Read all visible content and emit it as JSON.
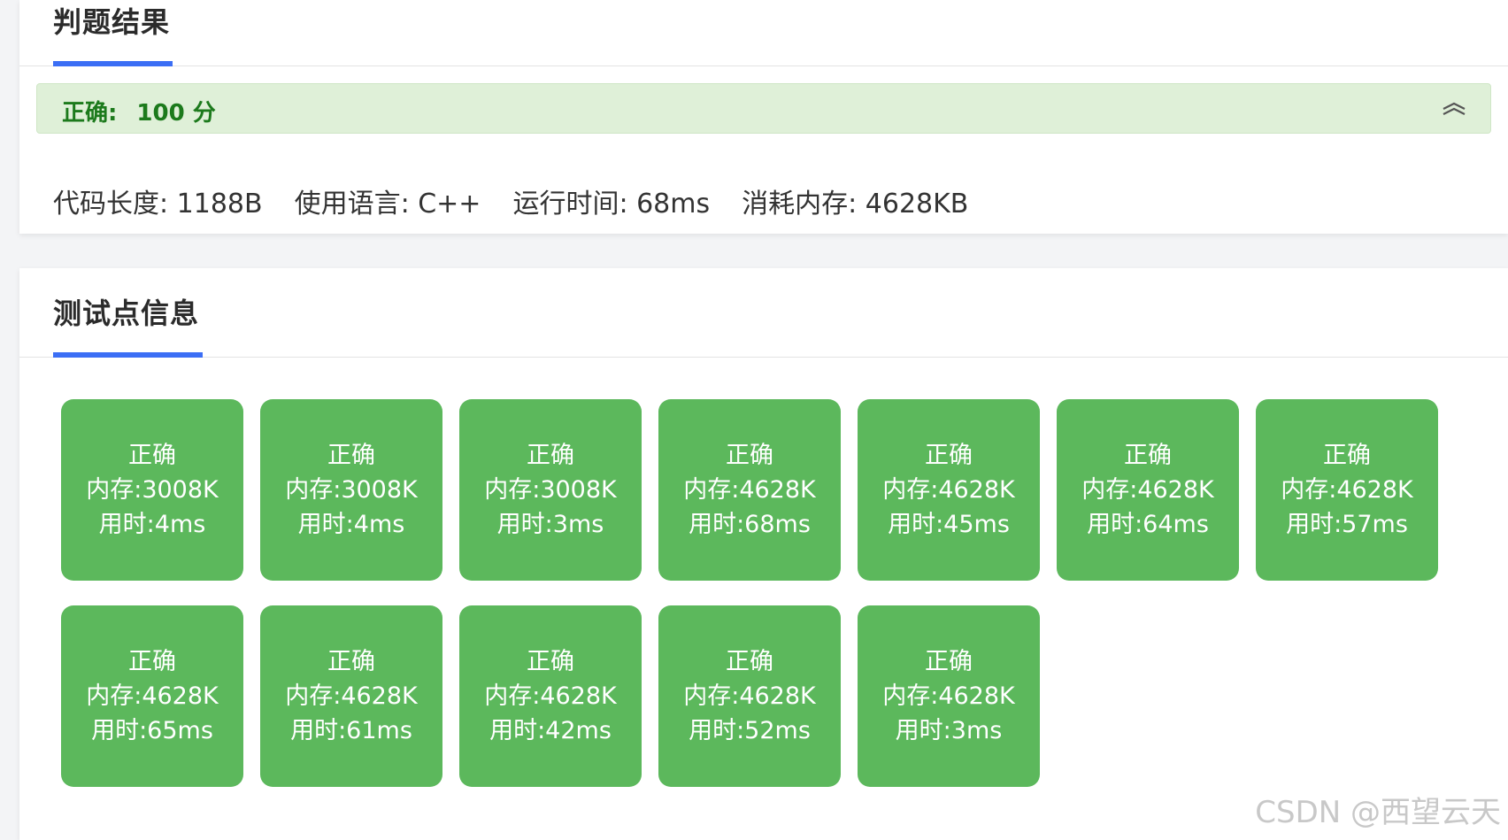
{
  "result": {
    "title": "判题结果",
    "verdict_label": "正确:",
    "verdict_score": "100 分",
    "collapse_icon": "chevron-double-up-icon",
    "stats": [
      {
        "label": "代码长度: 1188B"
      },
      {
        "label": "使用语言: C++"
      },
      {
        "label": "运行时间: 68ms"
      },
      {
        "label": "消耗内存: 4628KB"
      }
    ]
  },
  "tests": {
    "title": "测试点信息",
    "cases": [
      {
        "status": "正确",
        "memory": "内存:3008K",
        "time": "用时:4ms"
      },
      {
        "status": "正确",
        "memory": "内存:3008K",
        "time": "用时:4ms"
      },
      {
        "status": "正确",
        "memory": "内存:3008K",
        "time": "用时:3ms"
      },
      {
        "status": "正确",
        "memory": "内存:4628K",
        "time": "用时:68ms"
      },
      {
        "status": "正确",
        "memory": "内存:4628K",
        "time": "用时:45ms"
      },
      {
        "status": "正确",
        "memory": "内存:4628K",
        "time": "用时:64ms"
      },
      {
        "status": "正确",
        "memory": "内存:4628K",
        "time": "用时:57ms"
      },
      {
        "status": "正确",
        "memory": "内存:4628K",
        "time": "用时:65ms"
      },
      {
        "status": "正确",
        "memory": "内存:4628K",
        "time": "用时:61ms"
      },
      {
        "status": "正确",
        "memory": "内存:4628K",
        "time": "用时:42ms"
      },
      {
        "status": "正确",
        "memory": "内存:4628K",
        "time": "用时:52ms"
      },
      {
        "status": "正确",
        "memory": "内存:4628K",
        "time": "用时:3ms"
      }
    ]
  },
  "colors": {
    "accent": "#3b6ef5",
    "success_tile": "#5cb85c",
    "verdict_bg": "#dff0d8",
    "verdict_text": "#1c7a1c"
  },
  "watermark": "CSDN @西望云天"
}
